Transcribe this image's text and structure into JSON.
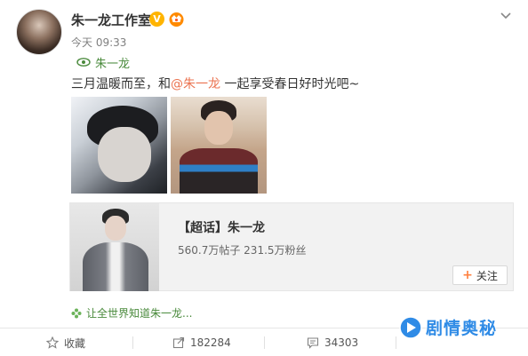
{
  "header": {
    "username": "朱一龙工作室",
    "verified_badge": "V",
    "timestamp": "今天 09:33"
  },
  "topic_tag": {
    "label": "朱一龙"
  },
  "post": {
    "text_before": "三月温暖而至，和",
    "mention": "@朱一龙",
    "text_after": " 一起享受春日好时光吧~"
  },
  "card": {
    "title": "【超话】朱一龙",
    "stats": "560.7万帖子 231.5万粉丝",
    "follow_label": "关注"
  },
  "source_line": {
    "label": "让全世界知道朱一龙..."
  },
  "actions": {
    "favorite_label": "收藏",
    "share_count": "182284",
    "comment_count": "34303"
  },
  "watermark": {
    "text": "剧情奥秘"
  },
  "colors": {
    "mention": "#eb7350",
    "topic_green": "#4a8a3c",
    "verified": "#ffb400",
    "watermark_blue": "#2f8be6"
  },
  "icons": {
    "verified": "verified-icon",
    "vip": "vip-icon",
    "dropdown": "chevron-down-icon",
    "topic": "supertopic-eye-icon",
    "favorite": "star-icon",
    "share": "share-icon",
    "comment": "comment-icon"
  }
}
